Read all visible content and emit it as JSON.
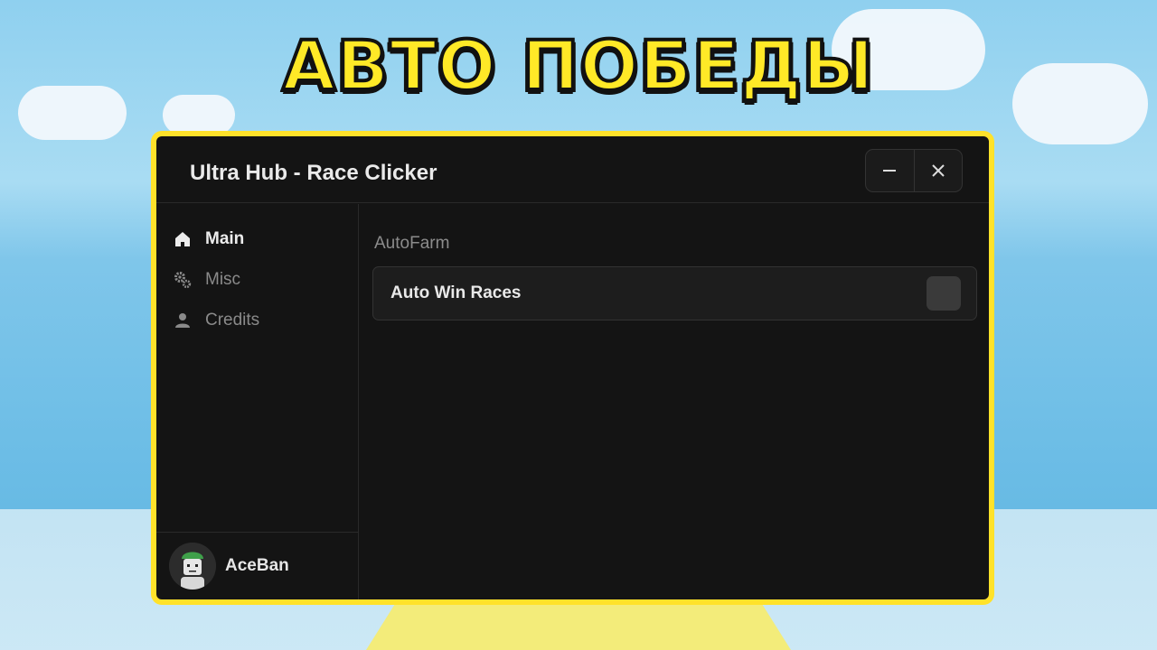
{
  "headline": "АВТО ПОБЕДЫ",
  "window": {
    "title": "Ultra Hub - Race Clicker",
    "minimize_icon": "minus-icon",
    "close_icon": "close-icon"
  },
  "sidebar": {
    "items": [
      {
        "label": "Main",
        "icon": "home-icon",
        "active": true
      },
      {
        "label": "Misc",
        "icon": "gears-icon",
        "active": false
      },
      {
        "label": "Credits",
        "icon": "person-icon",
        "active": false
      }
    ],
    "profile": {
      "username": "AceBan"
    }
  },
  "content": {
    "section_title": "AutoFarm",
    "toggles": [
      {
        "label": "Auto Win Races",
        "checked": false
      }
    ]
  },
  "colors": {
    "accent_border": "#ffe22a",
    "window_bg": "#141414",
    "headline": "#ffe927"
  }
}
